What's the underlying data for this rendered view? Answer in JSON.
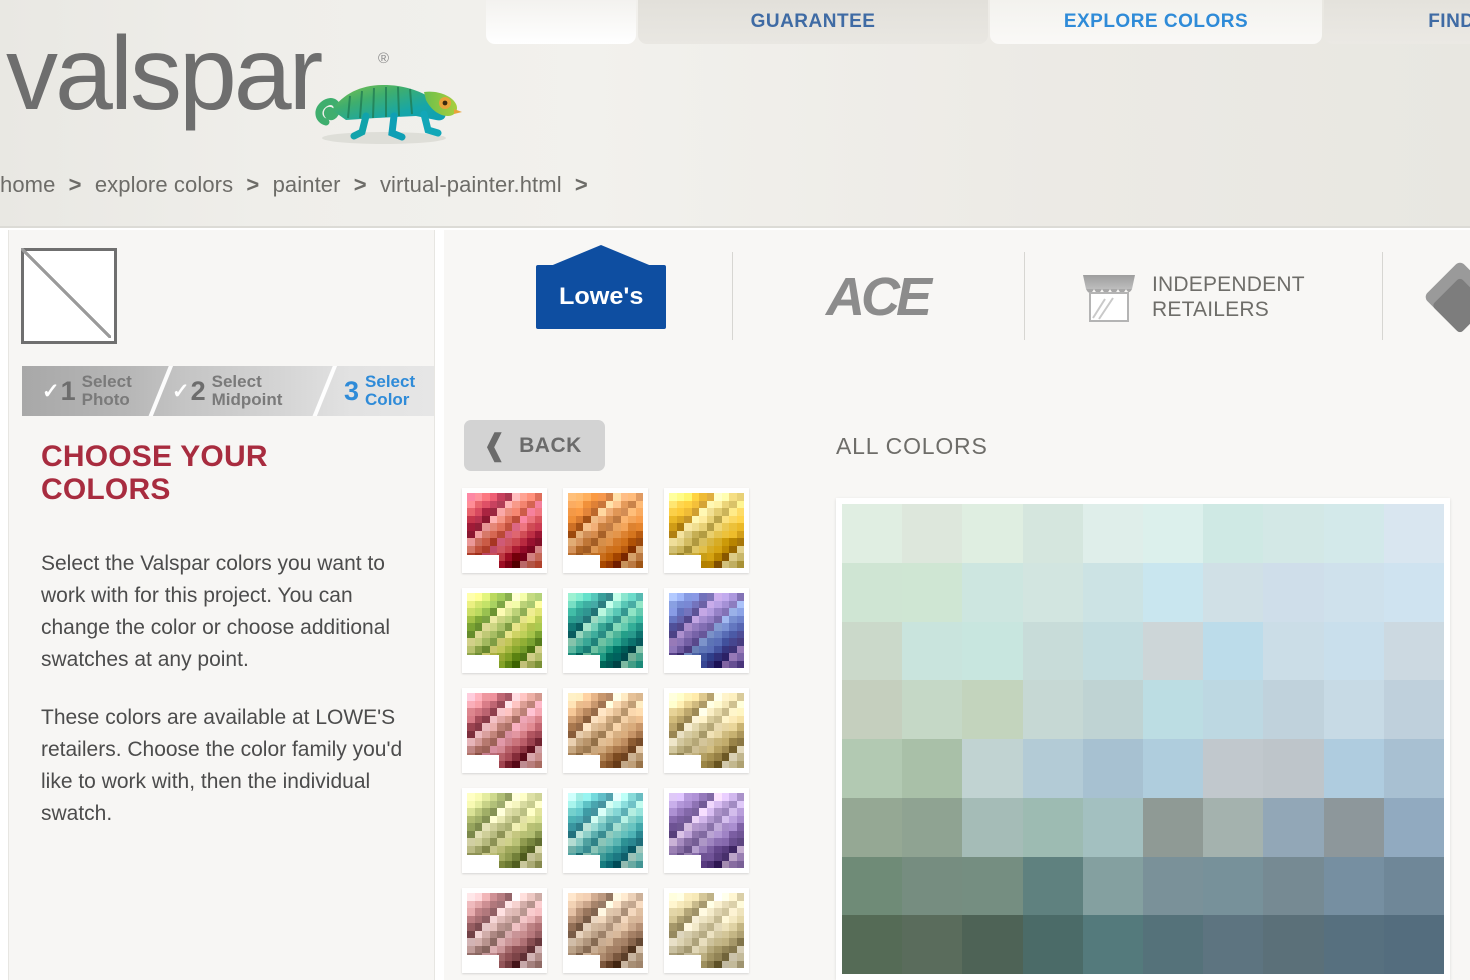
{
  "brand": {
    "logo_text": "valspar",
    "registered_mark": "®",
    "mascot_icon": "chameleon-icon"
  },
  "topnav": {
    "tabs": [
      {
        "label": "",
        "state": "blank"
      },
      {
        "label": "GUARANTEE",
        "state": "inactive"
      },
      {
        "label": "EXPLORE COLORS",
        "state": "active"
      },
      {
        "label": "FIND THE",
        "state": "inactive"
      }
    ],
    "active_color": "#2f8bd8",
    "inactive_color": "#3f6ba4"
  },
  "breadcrumb": {
    "items": [
      "home",
      "explore colors",
      "painter",
      "virtual-painter.html"
    ],
    "separator": ">",
    "trailing_separator": ">"
  },
  "sidebar": {
    "color_slot": {
      "state": "empty",
      "icon": "empty-swatch-icon"
    },
    "steps": [
      {
        "number": "1",
        "label_line1": "Select",
        "label_line2": "Photo",
        "complete": true,
        "active": false
      },
      {
        "number": "2",
        "label_line1": "Select",
        "label_line2": "Midpoint",
        "complete": true,
        "active": false
      },
      {
        "number": "3",
        "label_line1": "Select",
        "label_line2": "Color",
        "complete": false,
        "active": true
      }
    ],
    "check_glyph": "✓",
    "title": "CHOOSE YOUR COLORS",
    "title_color": "#a82c3f",
    "paragraphs": [
      "Select the Valspar colors you want to work with for this project. You can change the color or choose additional swatches at any point.",
      "These colors are available at LOWE'S retailers. Choose the color family you'd like to work with, then the individual swatch."
    ]
  },
  "retailers": [
    {
      "name": "Lowe's",
      "label": "Lowe's",
      "icon": "lowes-logo",
      "brand_color": "#0e4ea1"
    },
    {
      "name": "Ace",
      "label": "ACE",
      "icon": "ace-logo"
    },
    {
      "name": "Independent Retailers",
      "label_line1": "INDEPENDENT",
      "label_line2": "RETAILERS",
      "icon": "storefront-icon"
    },
    {
      "name": "Partial",
      "label": "",
      "icon": "diamond-logo"
    }
  ],
  "toolbar": {
    "back_label": "BACK",
    "back_icon": "chevron-left-icon",
    "all_colors_label": "ALL COLORS"
  },
  "color_families": [
    {
      "name": "reds",
      "colors": [
        "#e8738f",
        "#e36a74",
        "#d9555e",
        "#c3344a",
        "#a51f3c",
        "#8e1a33",
        "#f2a0a0",
        "#e88a7a",
        "#d96a55",
        "#c45340"
      ]
    },
    {
      "name": "oranges",
      "colors": [
        "#f0a964",
        "#efa055",
        "#e98e3c",
        "#e08029",
        "#c86a1f",
        "#a9561a",
        "#f5c089",
        "#eaa870",
        "#d98f4f",
        "#b9733a"
      ]
    },
    {
      "name": "yellows",
      "colors": [
        "#f6dc7a",
        "#f5d35e",
        "#f3c841",
        "#edbb2a",
        "#d9a51f",
        "#b9881a",
        "#f9e8a4",
        "#eedc8f",
        "#ddc66b",
        "#c0a94f"
      ]
    },
    {
      "name": "yellow-greens",
      "colors": [
        "#e6e489",
        "#d8dd6e",
        "#bfd15a",
        "#a6c44a",
        "#85ad3c",
        "#6a9130",
        "#eceaa3",
        "#cfd885",
        "#aec46a",
        "#8aa84f"
      ]
    },
    {
      "name": "greens-teals",
      "colors": [
        "#7fd3b4",
        "#5cc3a8",
        "#38b39d",
        "#2a9b8e",
        "#1f8480",
        "#17696c",
        "#a2dfc7",
        "#6ec9b2",
        "#40ae9d",
        "#2b8e86"
      ]
    },
    {
      "name": "blues-purples",
      "colors": [
        "#8fa6dd",
        "#7b92d4",
        "#6b7fc8",
        "#5d6cb8",
        "#5a5aa3",
        "#52488c",
        "#b79ad8",
        "#9d86c9",
        "#8470b5",
        "#6b5b9e"
      ]
    },
    {
      "name": "pinks",
      "colors": [
        "#f0a8b8",
        "#e79ba6",
        "#d88189",
        "#c46873",
        "#a74f5c",
        "#8b3c4a",
        "#f5c3c8",
        "#e2a8a6",
        "#cb8e84",
        "#ad7268"
      ]
    },
    {
      "name": "tans",
      "colors": [
        "#f2cfa5",
        "#eac295",
        "#dcae7e",
        "#c9976a",
        "#ae7d53",
        "#8f6340",
        "#f7ddbd",
        "#e6c69f",
        "#cfaa80",
        "#b08d64"
      ]
    },
    {
      "name": "creams",
      "colors": [
        "#f4e5ba",
        "#eeddaa",
        "#e3cf93",
        "#d3bd7d",
        "#b8a267",
        "#998551",
        "#f8efd2",
        "#eadfb6",
        "#d6c999",
        "#bcae7e"
      ]
    },
    {
      "name": "light-greens",
      "colors": [
        "#e9e8ac",
        "#dbdd96",
        "#c7cf83",
        "#b0bb70",
        "#94a25b",
        "#7a8749",
        "#eeecc0",
        "#d9d9a3",
        "#c2c58a",
        "#a6ab6e"
      ]
    },
    {
      "name": "aquas",
      "colors": [
        "#a9e3d6",
        "#8bd7cf",
        "#6ac6c3",
        "#4cb0b3",
        "#3a96a0",
        "#2c7b87",
        "#c2eae0",
        "#98d9d2",
        "#6dbfbe",
        "#4c9fa4"
      ]
    },
    {
      "name": "violets",
      "colors": [
        "#c7b1e0",
        "#b49ad6",
        "#a084c6",
        "#8d70b4",
        "#7a5fa0",
        "#664e8a",
        "#dcc4e8",
        "#c0a5d9",
        "#a58cc2",
        "#8a73aa"
      ]
    },
    {
      "name": "rose-neutrals",
      "colors": [
        "#edc0c2",
        "#e0abae",
        "#cc9193",
        "#b87a7e",
        "#9c6367",
        "#7f4e53",
        "#f2d3d4",
        "#ddb9b6",
        "#c39e99",
        "#a6847e"
      ]
    },
    {
      "name": "beige-browns",
      "colors": [
        "#e9cdb3",
        "#ddbd9f",
        "#c9a68a",
        "#b38e73",
        "#96735a",
        "#775a45",
        "#f0dcc7",
        "#dcc3a9",
        "#c2a78e",
        "#a68a72"
      ]
    },
    {
      "name": "ivories",
      "colors": [
        "#f2e8c8",
        "#eadfb8",
        "#ddd0a2",
        "#cbbd8c",
        "#b0a274",
        "#94875d",
        "#f6eed6",
        "#e9e0c0",
        "#d5caa6",
        "#bbb089"
      ]
    }
  ],
  "all_colors": {
    "label": "ALL COLORS",
    "columns": 10,
    "rows": 8,
    "grid": [
      [
        "#e0eee2",
        "#dde7dc",
        "#dfeee1",
        "#d5e6de",
        "#dfeeea",
        "#dcf0ec",
        "#cfe9e4",
        "#d3e8e6",
        "#d3e9ea",
        "#d9e6f0"
      ],
      [
        "#cfe5d3",
        "#cfe6d3",
        "#cde6e0",
        "#d2e5e0",
        "#cce3e4",
        "#c9e6ef",
        "#d0e0e6",
        "#cfdeea",
        "#cfe1ec",
        "#cfe3f0"
      ],
      [
        "#cbd9ca",
        "#c9e4dd",
        "#c8e6df",
        "#c8dcd9",
        "#c3dde0",
        "#cdd6d8",
        "#bcdcea",
        "#cbdde7",
        "#c9dfec",
        "#ccd9e1"
      ],
      [
        "#c5cfbe",
        "#c5d8c6",
        "#c3d4bd",
        "#c6d8d4",
        "#bfd3d3",
        "#bcdde3",
        "#bdd8e2",
        "#c0d2dc",
        "#c7dae5",
        "#bfd0dc"
      ],
      [
        "#b2c9b2",
        "#a9c0a8",
        "#c1d3d2",
        "#b3cbd6",
        "#a7c1d1",
        "#afcddd",
        "#c1c8cd",
        "#bec5ca",
        "#afccdf",
        "#a8c0d2"
      ],
      [
        "#95a894",
        "#8fa392",
        "#a5bcb7",
        "#9dbbb2",
        "#a3c0c0",
        "#8f9a95",
        "#a4b2ae",
        "#92a7b7",
        "#8d979b",
        "#91aac0"
      ],
      [
        "#6f8b77",
        "#768d80",
        "#758e81",
        "#5f817f",
        "#84a0a0",
        "#7a9199",
        "#77919a",
        "#768a93",
        "#768fa1",
        "#6f8798"
      ],
      [
        "#556b56",
        "#5a6c5c",
        "#4e6356",
        "#4b6b68",
        "#547a7c",
        "#55727a",
        "#5d7480",
        "#5b7079",
        "#57707f",
        "#546d7e"
      ]
    ]
  }
}
